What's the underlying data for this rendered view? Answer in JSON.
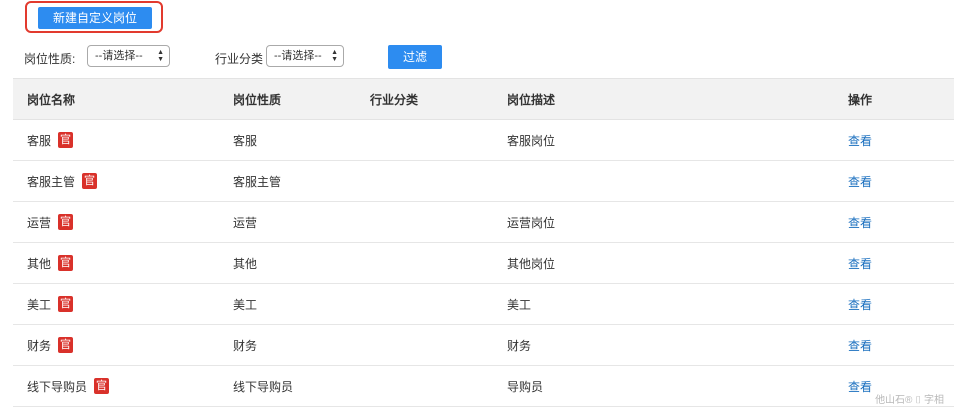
{
  "toolbar": {
    "new_button": "新建自定义岗位"
  },
  "filters": {
    "nature_label": "岗位性质:",
    "nature_value": "--请选择--",
    "industry_label": "行业分类",
    "industry_value": "--请选择--",
    "filter_button": "过滤"
  },
  "table": {
    "headers": [
      "岗位名称",
      "岗位性质",
      "行业分类",
      "岗位描述",
      "操作"
    ],
    "rows": [
      {
        "name": "客服",
        "badge": "官",
        "nature": "客服",
        "industry": "",
        "desc": "客服岗位",
        "action": "查看"
      },
      {
        "name": "客服主管",
        "badge": "官",
        "nature": "客服主管",
        "industry": "",
        "desc": "",
        "action": "查看"
      },
      {
        "name": "运营",
        "badge": "官",
        "nature": "运营",
        "industry": "",
        "desc": "运营岗位",
        "action": "查看"
      },
      {
        "name": "其他",
        "badge": "官",
        "nature": "其他",
        "industry": "",
        "desc": "其他岗位",
        "action": "查看"
      },
      {
        "name": "美工",
        "badge": "官",
        "nature": "美工",
        "industry": "",
        "desc": "美工",
        "action": "查看"
      },
      {
        "name": "财务",
        "badge": "官",
        "nature": "财务",
        "industry": "",
        "desc": "财务",
        "action": "查看"
      },
      {
        "name": "线下导购员",
        "badge": "官",
        "nature": "线下导购员",
        "industry": "",
        "desc": "导购员",
        "action": "查看"
      }
    ]
  },
  "watermark": "他山石® ⌷ 字相",
  "colors": {
    "primary": "#2d8cf0",
    "badge": "#d9312a",
    "link": "#1a6fbf",
    "highlight": "#e23a2e"
  }
}
